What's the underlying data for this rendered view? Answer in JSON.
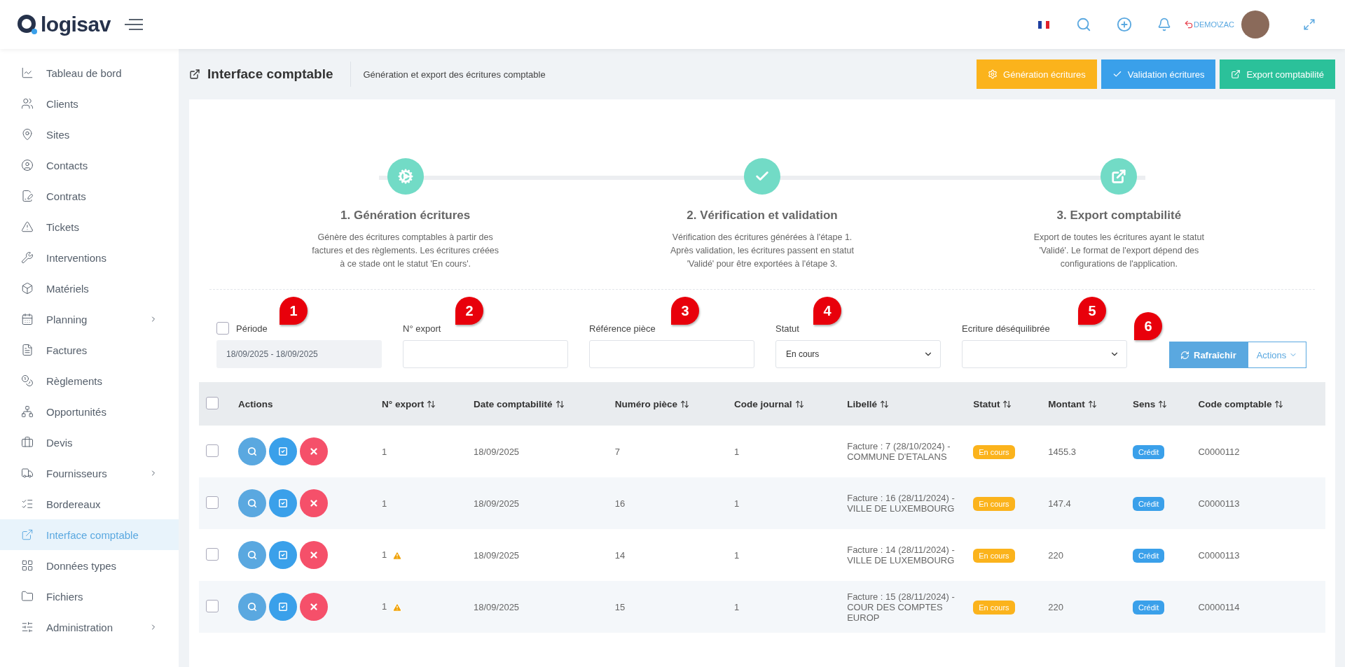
{
  "header": {
    "logo": "logisav",
    "user": "DEMO\\ZAC"
  },
  "sidebar": {
    "items": [
      {
        "label": "Tableau de bord",
        "selected": false,
        "has_children": false
      },
      {
        "label": "Clients",
        "selected": false,
        "has_children": false
      },
      {
        "label": "Sites",
        "selected": false,
        "has_children": false
      },
      {
        "label": "Contacts",
        "selected": false,
        "has_children": false
      },
      {
        "label": "Contrats",
        "selected": false,
        "has_children": false
      },
      {
        "label": "Tickets",
        "selected": false,
        "has_children": false
      },
      {
        "label": "Interventions",
        "selected": false,
        "has_children": false
      },
      {
        "label": "Matériels",
        "selected": false,
        "has_children": false
      },
      {
        "label": "Planning",
        "selected": false,
        "has_children": true
      },
      {
        "label": "Factures",
        "selected": false,
        "has_children": false
      },
      {
        "label": "Règlements",
        "selected": false,
        "has_children": false
      },
      {
        "label": "Opportunités",
        "selected": false,
        "has_children": false
      },
      {
        "label": "Devis",
        "selected": false,
        "has_children": false
      },
      {
        "label": "Fournisseurs",
        "selected": false,
        "has_children": true
      },
      {
        "label": "Bordereaux",
        "selected": false,
        "has_children": false
      },
      {
        "label": "Interface comptable",
        "selected": true,
        "has_children": false
      },
      {
        "label": "Données types",
        "selected": false,
        "has_children": false
      },
      {
        "label": "Fichiers",
        "selected": false,
        "has_children": false
      },
      {
        "label": "Administration",
        "selected": false,
        "has_children": true
      }
    ]
  },
  "page": {
    "title": "Interface comptable",
    "subtitle": "Génération et export des écritures comptable",
    "buttons": [
      {
        "label": "Génération écritures",
        "kind": "generate"
      },
      {
        "label": "Validation écritures",
        "kind": "validate"
      },
      {
        "label": "Export comptabilité",
        "kind": "export"
      }
    ]
  },
  "steps": [
    {
      "title": "1. Génération écritures",
      "description": "Génère des écritures comptables à partir des factures et des règlements. Les écritures créées à ce stade ont le statut 'En cours'."
    },
    {
      "title": "2. Vérification et validation",
      "description": "Vérification des écritures générées à l'étape 1. Après validation, les écritures passent en statut 'Validé' pour être exportées à l'étape 3."
    },
    {
      "title": "3. Export comptabilité",
      "description": "Export de toutes les écritures ayant le statut 'Validé'. Le format de l'export dépend des configurations de l'application."
    }
  ],
  "filters": [
    {
      "kind": "period",
      "label": "Période",
      "marker": "1",
      "checked": false,
      "value": "18/09/2025 - 18/09/2025"
    },
    {
      "kind": "text",
      "label": "N° export",
      "marker": "2"
    },
    {
      "kind": "text",
      "label": "Référence pièce",
      "marker": "3"
    },
    {
      "kind": "select",
      "label": "Statut",
      "marker": "4",
      "value": "En cours"
    },
    {
      "kind": "select",
      "label": "Ecriture déséquilibrée",
      "marker": "5"
    }
  ],
  "refresh": {
    "label": "Rafraîchir",
    "marker": "6"
  },
  "actions_button": "Actions",
  "table": {
    "select_all_checked": false,
    "columns": [
      "Actions",
      "N° export",
      "Date comptabilité",
      "Numéro pièce",
      "Code journal",
      "Libellé",
      "Statut",
      "Montant",
      "Sens",
      "Code comptable"
    ],
    "rows": [
      {
        "checked": false,
        "export": "1",
        "warning": false,
        "date": "18/09/2025",
        "piece": "7",
        "journal": "1",
        "libelle": "Facture : 7 (28/10/2024) - COMMUNE D'ETALANS",
        "statut": "En cours",
        "montant": "1455.3",
        "sens": "Crédit",
        "code": "C0000112"
      },
      {
        "checked": false,
        "export": "1",
        "warning": false,
        "date": "18/09/2025",
        "piece": "16",
        "journal": "1",
        "libelle": "Facture : 16 (28/11/2024) - VILLE DE LUXEMBOURG",
        "statut": "En cours",
        "montant": "147.4",
        "sens": "Crédit",
        "code": "C0000113"
      },
      {
        "checked": false,
        "export": "1",
        "warning": true,
        "date": "18/09/2025",
        "piece": "14",
        "journal": "1",
        "libelle": "Facture : 14 (28/11/2024) - VILLE DE LUXEMBOURG",
        "statut": "En cours",
        "montant": "220",
        "sens": "Crédit",
        "code": "C0000113"
      },
      {
        "checked": false,
        "export": "1",
        "warning": true,
        "date": "18/09/2025",
        "piece": "15",
        "journal": "1",
        "libelle": "Facture : 15 (28/11/2024) - COUR DES COMPTES EUROP",
        "statut": "En cours",
        "montant": "220",
        "sens": "Crédit",
        "code": "C0000114"
      }
    ]
  }
}
